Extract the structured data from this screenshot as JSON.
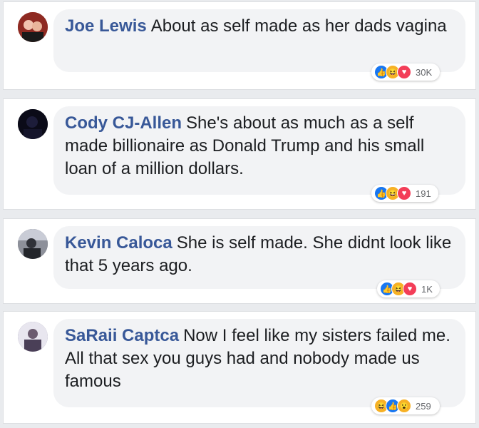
{
  "comments": [
    {
      "author": "Joe Lewis",
      "text": "About as self made as her dads vagina",
      "reactions": [
        "like",
        "haha",
        "love"
      ],
      "count": "30K",
      "avatar_colors": [
        "#b03a2e",
        "#f1c4b0"
      ]
    },
    {
      "author": "Cody CJ-Allen",
      "text": "She's about as much as a self made billionaire as Donald Trump and his small loan of a million dollars.",
      "reactions": [
        "like",
        "haha",
        "love"
      ],
      "count": "191",
      "avatar_colors": [
        "#0d0d1f",
        "#2a2a55"
      ]
    },
    {
      "author": "Kevin Caloca",
      "text": "She is self made. She didnt look like that 5 years ago.",
      "reactions": [
        "like",
        "haha",
        "love"
      ],
      "count": "1K",
      "avatar_colors": [
        "#4a4d57",
        "#c9ccd6"
      ]
    },
    {
      "author": "SaRaii Captca",
      "text": "Now I feel like my sisters failed me. All that sex you guys had and nobody made us famous",
      "reactions": [
        "haha",
        "like",
        "wow"
      ],
      "count": "259",
      "avatar_colors": [
        "#6d6a8a",
        "#e8e6ef"
      ]
    }
  ],
  "colors": {
    "author": "#385898",
    "bubble": "#f2f3f5",
    "like": "#1877f2",
    "love": "#f33e58",
    "haha": "#f7b125"
  }
}
